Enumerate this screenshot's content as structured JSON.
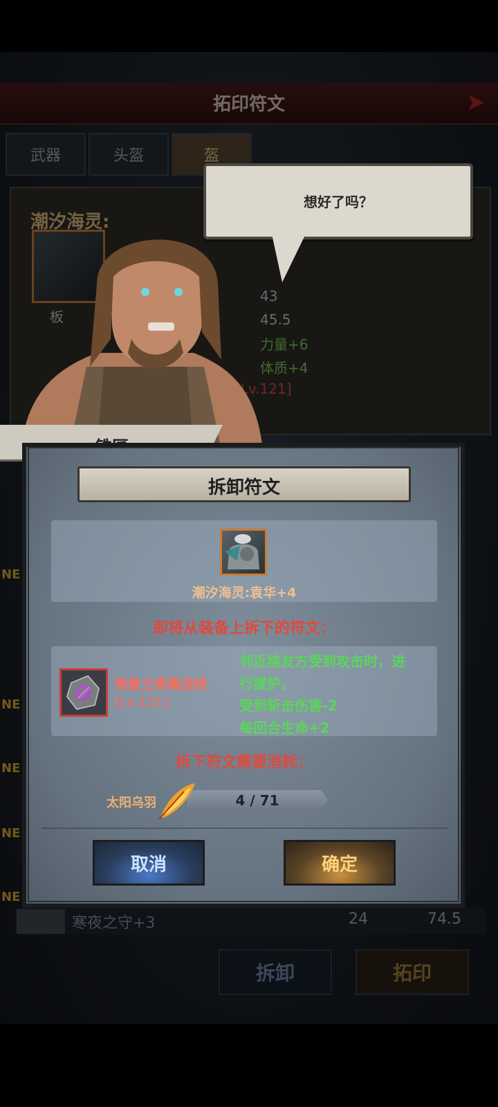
{
  "background_screen": {
    "title": "拓印符文",
    "tabs": [
      "武器",
      "头盔",
      "盔"
    ],
    "item_name": "潮汐海灵:",
    "item_label": "板",
    "stats": [
      "43",
      "45.5",
      "力量+6",
      "体质+4",
      "[Lv.121]"
    ],
    "ne_labels": [
      "NE",
      "NE",
      "NE",
      "NE",
      "NE"
    ],
    "row": {
      "name": "寒夜之守+3",
      "value1": "24",
      "value2": "74.5"
    },
    "buttons": {
      "dismantle": "拆卸",
      "rubbing": "拓印"
    }
  },
  "npc": {
    "name": "铁匠",
    "speech": "想好了吗？"
  },
  "dialog": {
    "title": "拆卸符文",
    "equipment_name": "潮汐海灵:袁华+4",
    "rune_heading": "即将从装备上拆下的符文：",
    "rune": {
      "name": "恢复之疼痛战线",
      "level": "[Lv.121]",
      "effects": [
        "邻近格友方受到攻击时，进",
        "行援护。",
        "受到斩击伤害-2",
        "每回合生命+2"
      ]
    },
    "cost_heading": "拆下符文需要消耗：",
    "cost": {
      "item_name": "太阳乌羽",
      "amount": "4 / 71"
    },
    "cancel_label": "取消",
    "confirm_label": "确定"
  },
  "colors": {
    "equipment_name": "#f0c090",
    "heading_red": "#e04a3c",
    "rune_red": "#ff6a5a",
    "effect_green": "#5ad65a",
    "cancel_blue": "#4a7ac8",
    "confirm_gold": "#c89040"
  },
  "icons": {
    "equipment": "armor-icon",
    "rune": "rune-stone-icon",
    "cost": "feather-icon",
    "back": "back-arrow-icon"
  }
}
